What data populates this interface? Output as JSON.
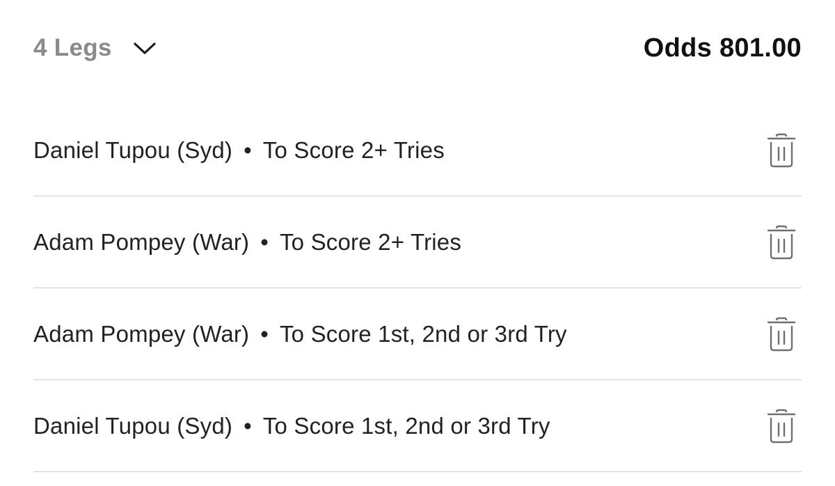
{
  "header": {
    "legs_label": "4 Legs",
    "odds_label": "Odds 801.00"
  },
  "legs": [
    {
      "selection": "Daniel Tupou (Syd)",
      "separator": "•",
      "market": "To Score 2+ Tries"
    },
    {
      "selection": "Adam Pompey (War)",
      "separator": "•",
      "market": "To Score 2+ Tries"
    },
    {
      "selection": "Adam Pompey (War)",
      "separator": "•",
      "market": "To Score 1st, 2nd or 3rd Try"
    },
    {
      "selection": "Daniel Tupou (Syd)",
      "separator": "•",
      "market": "To Score 1st, 2nd or 3rd Try"
    }
  ],
  "icons": {
    "expand": "chevron-down-icon",
    "remove": "trash-icon"
  },
  "colors": {
    "muted_text": "#8a8a8a",
    "primary_text": "#111111",
    "divider": "#cfcfcf",
    "icon": "#6f6f6f"
  }
}
